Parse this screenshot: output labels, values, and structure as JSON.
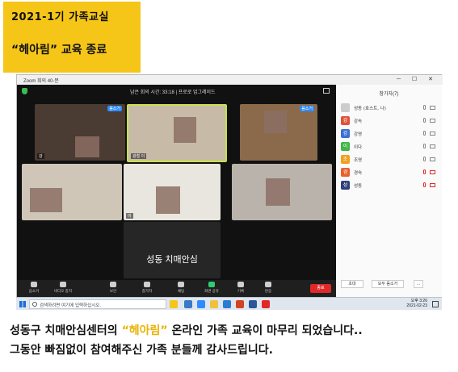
{
  "banner": {
    "line1": "2021-1기 가족교실",
    "line2": "“헤아림” 교육 종료"
  },
  "zoom": {
    "window_title": "Zoom 회의 40-분",
    "timer": "남은 회의 시간: 33:18 | 프로로 업그레이드",
    "tiles": [
      {
        "name": "강",
        "badge": "음소거"
      },
      {
        "name": "",
        "badge": ""
      },
      {
        "name": "광철 이",
        "badge": "음소거"
      },
      {
        "name": "",
        "badge": ""
      },
      {
        "name": "",
        "badge": ""
      },
      {
        "name": "",
        "badge": ""
      },
      {
        "name": "이",
        "badge": ""
      },
      {
        "name": "",
        "badge": ""
      }
    ],
    "big_tile_name": "성동 치매안심",
    "toolbar": [
      {
        "label": "음소거",
        "icon": "microphone-icon"
      },
      {
        "label": "비디오 중지",
        "icon": "video-camera-icon"
      },
      {
        "label": "보안",
        "icon": "security-shield-icon"
      },
      {
        "label": "참가자",
        "count": "7",
        "icon": "participants-icon"
      },
      {
        "label": "채팅",
        "icon": "chat-icon"
      },
      {
        "label": "화면 공유",
        "icon": "share-screen-icon"
      },
      {
        "label": "기록",
        "icon": "record-icon"
      },
      {
        "label": "반응",
        "icon": "reaction-icon"
      }
    ],
    "end_button": "종료",
    "panel": {
      "title": "참가자(7)",
      "participants": [
        {
          "initial": "",
          "name": "성동 (호스트, 나)",
          "color": "#cccccc",
          "muted": false
        },
        {
          "initial": "강",
          "name": "강속",
          "color": "#e0523a",
          "muted": false
        },
        {
          "initial": "강",
          "name": "강영",
          "color": "#3b6fd4",
          "muted": false
        },
        {
          "initial": "이",
          "name": "이다",
          "color": "#3fb54a",
          "muted": false
        },
        {
          "initial": "조",
          "name": "조영",
          "color": "#f0a020",
          "muted": false
        },
        {
          "initial": "경",
          "name": "경숙",
          "color": "#e8602c",
          "muted": true
        },
        {
          "initial": "성",
          "name": "성동",
          "color": "#2e3f7a",
          "muted": true
        }
      ],
      "invite_button": "초대",
      "mute_all_button": "모두 음소거",
      "more_button": "..."
    }
  },
  "taskbar": {
    "search_placeholder": "검색하려면 여기에 입력하십시오.",
    "time": "오후 3:26",
    "date": "2021-02-23"
  },
  "caption": {
    "line1_pre": "성동구 치매안심센터의 ",
    "line1_highlight": "“헤아림”",
    "line1_post": " 온라인 가족 교육이 마무리 되었습니다..",
    "line2": "그동안 빠짐없이 참여해주신 가족 분들께 감사드립니다."
  }
}
